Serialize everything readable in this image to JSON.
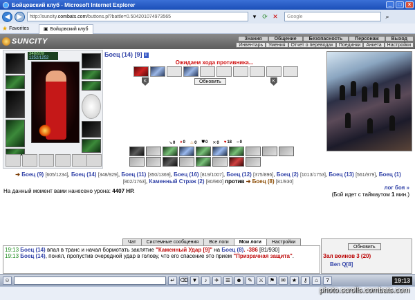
{
  "browser": {
    "title": "Бойцовский клуб - Microsoft Internet Explorer",
    "url_prefix": "http://suncity.",
    "url_domain": "combats.com",
    "url_suffix": "/buttons.pl?battle=0.504201074973565",
    "search_placeholder": "Google",
    "favorites_label": "Favorites",
    "tab_label": "Бойцовский клуб"
  },
  "game": {
    "logo": "SUNCITY",
    "menu_top": [
      "Знания",
      "Общение",
      "Безопасность",
      "Персонаж",
      "Выход"
    ],
    "menu_sub": [
      "Инвентарь",
      "Умения",
      "Отчет о переводах",
      "Поединки",
      "Анкета",
      "Настройки"
    ]
  },
  "player": {
    "hp": "348/939",
    "mana": "1252/1252"
  },
  "enemy": {
    "title": "Боец (14) [9]",
    "info_icon": "i"
  },
  "battle": {
    "wait_message": "Ожидаем хода противника...",
    "refresh_label": "Обновить",
    "effects": [
      {
        "icon": "arrow-icon",
        "value": "0"
      },
      {
        "icon": "drop-icon",
        "value": "0"
      },
      {
        "icon": "fire-icon",
        "value": "0"
      },
      {
        "icon": "shield-icon",
        "value": "0"
      },
      {
        "icon": "swords-icon",
        "value": "0"
      },
      {
        "icon": "heart-icon",
        "value": "18"
      },
      {
        "icon": "ring-icon",
        "value": "0"
      }
    ],
    "damage_prefix": "На данный момент вами нанесено урона:",
    "damage_value": "4407 HP.",
    "log_link": "лог боя »",
    "timeout_prefix": "(Бой идет с таймаутом",
    "timeout_value": "1",
    "timeout_suffix": "мин.)"
  },
  "teams": {
    "team1": [
      {
        "name": "Боец (9)",
        "hp": "[605/1234]"
      },
      {
        "name": "Боец (14)",
        "hp": "[348/929]"
      },
      {
        "name": "Боец (11)",
        "hp": "[350/1369]"
      },
      {
        "name": "Боец (16)",
        "hp": "[819/1007]"
      },
      {
        "name": "Боец (12)",
        "hp": "[375/896]"
      },
      {
        "name": "Боец (2)",
        "hp": "[1013/1753]"
      },
      {
        "name": "Боец (13)",
        "hp": "[561/979]"
      },
      {
        "name": "Боец (1)",
        "hp": "[802/1763]"
      },
      {
        "name": "Каменный Страж (2)",
        "hp": "[80/960]"
      }
    ],
    "versus": "против",
    "team2": [
      {
        "name": "Боец (8)",
        "hp": "[81/930]"
      }
    ]
  },
  "chat": {
    "tabs": [
      "Чат",
      "Системные сообщения",
      "Все логи",
      "Мои логи",
      "Настройки"
    ],
    "active_tab": "Мои логи",
    "lines": [
      {
        "time": "19:13",
        "name": "Боец (14)",
        "text1": " впал в транс и начал бормотать заклятие ",
        "spell": "\"Каменный Удар [9]\"",
        "text2": " на ",
        "target": "Боец (8)",
        "damage": ". -386",
        "hp": "[81/930]"
      },
      {
        "time": "19:13",
        "name": "Боец (14)",
        "text1": ", понял, пропустив очередной удар в голову, что его спасение это прием ",
        "spell": "\"Призрачная защита\"",
        "text2": ".",
        "target": "",
        "damage": "",
        "hp": ""
      }
    ]
  },
  "room": {
    "refresh_label": "Обновить",
    "name": "Зал воинов 3 (20)",
    "user": "Ben Q[8]"
  },
  "clock": "19:13",
  "watermark": "photo.scrolls.combats.com"
}
